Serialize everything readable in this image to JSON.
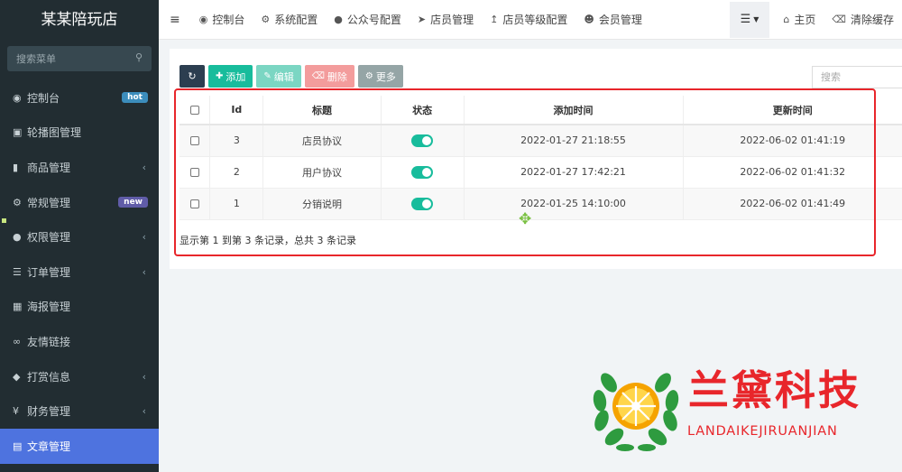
{
  "sidebar": {
    "brand": "某某陪玩店",
    "search_placeholder": "搜索菜单",
    "items": [
      {
        "label": "控制台",
        "icon": "dashboard-icon",
        "badge": "hot"
      },
      {
        "label": "轮播图管理",
        "icon": "image-icon"
      },
      {
        "label": "商品管理",
        "icon": "book-icon",
        "chevron": true
      },
      {
        "label": "常规管理",
        "icon": "cogs-icon",
        "badge": "new"
      },
      {
        "label": "权限管理",
        "icon": "users-icon",
        "chevron": true
      },
      {
        "label": "订单管理",
        "icon": "list-icon",
        "chevron": true
      },
      {
        "label": "海报管理",
        "icon": "picture-icon"
      },
      {
        "label": "友情链接",
        "icon": "link-icon"
      },
      {
        "label": "打赏信息",
        "icon": "gift-icon",
        "chevron": true
      },
      {
        "label": "财务管理",
        "icon": "yen-icon",
        "chevron": true
      },
      {
        "label": "文章管理",
        "icon": "newspaper-icon",
        "active": true
      }
    ]
  },
  "topnav": {
    "tabs": [
      {
        "label": "控制台",
        "icon": "dashboard-icon"
      },
      {
        "label": "系统配置",
        "icon": "gear-icon"
      },
      {
        "label": "公众号配置",
        "icon": "wechat-icon"
      },
      {
        "label": "店员管理",
        "icon": "send-icon"
      },
      {
        "label": "店员等级配置",
        "icon": "level-icon"
      },
      {
        "label": "会员管理",
        "icon": "user-icon"
      }
    ],
    "home": "主页",
    "clear_cache": "清除缓存"
  },
  "toolbar": {
    "add": "添加",
    "edit": "编辑",
    "delete": "删除",
    "more": "更多",
    "search_placeholder": "搜索"
  },
  "table": {
    "columns": [
      "Id",
      "标题",
      "状态",
      "添加时间",
      "更新时间"
    ],
    "rows": [
      {
        "id": "3",
        "title": "店员协议",
        "status": true,
        "created": "2022-01-27 21:18:55",
        "updated": "2022-06-02 01:41:19"
      },
      {
        "id": "2",
        "title": "用户协议",
        "status": true,
        "created": "2022-01-27 17:42:21",
        "updated": "2022-06-02 01:41:32"
      },
      {
        "id": "1",
        "title": "分销说明",
        "status": true,
        "created": "2022-01-25 14:10:00",
        "updated": "2022-06-02 01:41:49"
      }
    ],
    "summary": "显示第 1 到第 3 条记录，总共 3 条记录"
  },
  "watermark": {
    "title": "兰黛科技",
    "subtitle": "LANDAIKEJIRUANJIAN"
  },
  "colors": {
    "sidebar_bg": "#222d32",
    "active_item": "#4e73df",
    "success": "#18bc9c",
    "highlight_border": "#e8262b"
  }
}
